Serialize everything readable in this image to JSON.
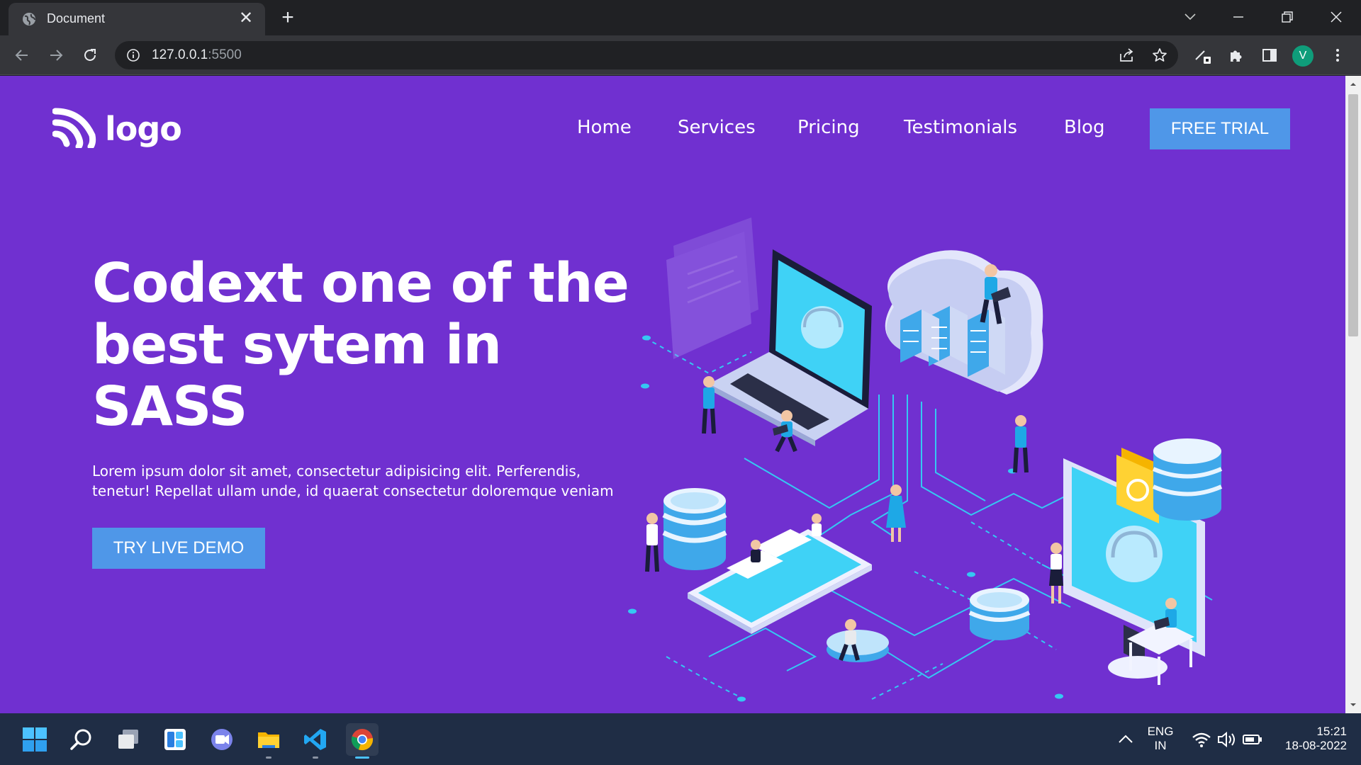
{
  "browser": {
    "tab": {
      "title": "Document",
      "close_glyph": "✕"
    },
    "new_tab_glyph": "+",
    "address": {
      "host": "127.0.0.1",
      "port": ":5500"
    },
    "profile_initial": "V"
  },
  "site": {
    "logo_text": "logo",
    "nav": [
      "Home",
      "Services",
      "Pricing",
      "Testimonials",
      "Blog"
    ],
    "cta_label": "FREE TRIAL",
    "hero": {
      "title": "Codext one of the best sytem in SASS",
      "text": "Lorem ipsum dolor sit amet, consectetur adipisicing elit. Perferendis, tenetur! Repellat ullam unde, id quaerat consectetur doloremque veniam",
      "button_label": "TRY LIVE DEMO"
    },
    "colors": {
      "background": "#7030d0",
      "button": "#4f97e8",
      "accent": "#2ec9f0"
    }
  },
  "taskbar": {
    "language": "ENG",
    "region": "IN",
    "time": "15:21",
    "date": "18-08-2022"
  }
}
